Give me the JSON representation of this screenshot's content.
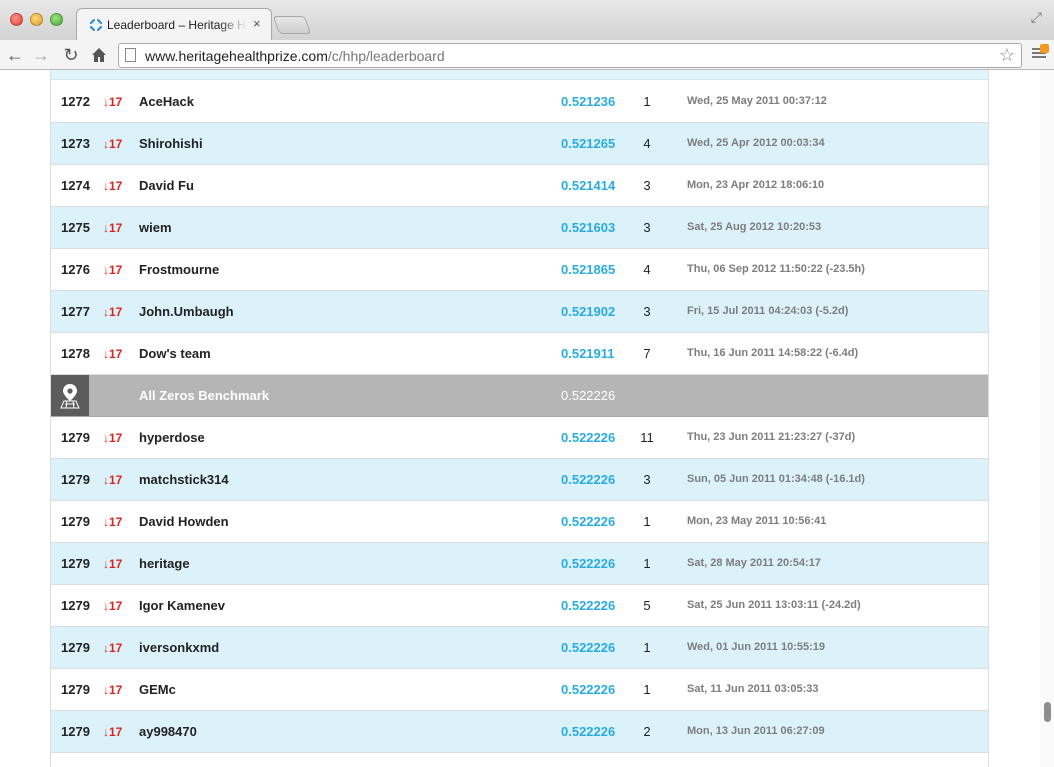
{
  "browser": {
    "tab_title": "Leaderboard – Heritage He",
    "tab_close": "×",
    "url_host": "www.heritagehealthprize.com",
    "url_path": "/c/hhp/leaderboard",
    "icons": {
      "back": "back-arrow-icon",
      "forward": "forward-arrow-icon",
      "reload": "reload-icon",
      "home": "home-icon",
      "bookmark": "star-icon",
      "menu": "hamburger-menu-icon",
      "fullscreen": "fullscreen-icon"
    }
  },
  "colors": {
    "alt_row": "#dcf2fa",
    "score": "#29abe2",
    "delta": "#d9251d",
    "benchmark_row": "#b5b5b5"
  },
  "leaderboard": {
    "rows": [
      {
        "rank": "1272",
        "delta": "↓17",
        "team": "AceHack",
        "score": "0.521236",
        "entries": "1",
        "last": "Wed, 25 May 2011 00:37:12"
      },
      {
        "rank": "1273",
        "delta": "↓17",
        "team": "Shirohishi",
        "score": "0.521265",
        "entries": "4",
        "last": "Wed, 25 Apr 2012 00:03:34"
      },
      {
        "rank": "1274",
        "delta": "↓17",
        "team": "David Fu",
        "score": "0.521414",
        "entries": "3",
        "last": "Mon, 23 Apr 2012 18:06:10"
      },
      {
        "rank": "1275",
        "delta": "↓17",
        "team": "wiem",
        "score": "0.521603",
        "entries": "3",
        "last": "Sat, 25 Aug 2012 10:20:53"
      },
      {
        "rank": "1276",
        "delta": "↓17",
        "team": "Frostmourne",
        "score": "0.521865",
        "entries": "4",
        "last": "Thu, 06 Sep 2012 11:50:22 (-23.5h)"
      },
      {
        "rank": "1277",
        "delta": "↓17",
        "team": "John.Umbaugh",
        "score": "0.521902",
        "entries": "3",
        "last": "Fri, 15 Jul 2011 04:24:03 (-5.2d)"
      },
      {
        "rank": "1278",
        "delta": "↓17",
        "team": "Dow's team",
        "score": "0.521911",
        "entries": "7",
        "last": "Thu, 16 Jun 2011 14:58:22 (-6.4d)"
      },
      {
        "benchmark": true,
        "team": "All Zeros Benchmark",
        "score": "0.522226",
        "icon": "map-pin-icon"
      },
      {
        "rank": "1279",
        "delta": "↓17",
        "team": "hyperdose",
        "score": "0.522226",
        "entries": "11",
        "last": "Thu, 23 Jun 2011 21:23:27 (-37d)"
      },
      {
        "rank": "1279",
        "delta": "↓17",
        "team": "matchstick314",
        "score": "0.522226",
        "entries": "3",
        "last": "Sun, 05 Jun 2011 01:34:48 (-16.1d)"
      },
      {
        "rank": "1279",
        "delta": "↓17",
        "team": "David Howden",
        "score": "0.522226",
        "entries": "1",
        "last": "Mon, 23 May 2011 10:56:41"
      },
      {
        "rank": "1279",
        "delta": "↓17",
        "team": "heritage",
        "score": "0.522226",
        "entries": "1",
        "last": "Sat, 28 May 2011 20:54:17"
      },
      {
        "rank": "1279",
        "delta": "↓17",
        "team": "Igor Kamenev",
        "score": "0.522226",
        "entries": "5",
        "last": "Sat, 25 Jun 2011 13:03:11 (-24.2d)"
      },
      {
        "rank": "1279",
        "delta": "↓17",
        "team": "iversonkxmd",
        "score": "0.522226",
        "entries": "1",
        "last": "Wed, 01 Jun 2011 10:55:19"
      },
      {
        "rank": "1279",
        "delta": "↓17",
        "team": "GEMc",
        "score": "0.522226",
        "entries": "1",
        "last": "Sat, 11 Jun 2011 03:05:33"
      },
      {
        "rank": "1279",
        "delta": "↓17",
        "team": "ay998470",
        "score": "0.522226",
        "entries": "2",
        "last": "Mon, 13 Jun 2011 06:27:09"
      }
    ]
  }
}
